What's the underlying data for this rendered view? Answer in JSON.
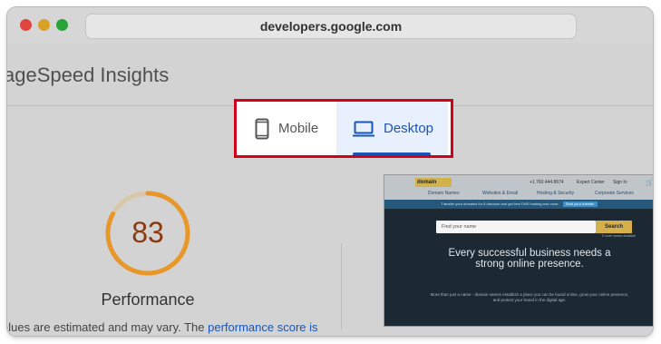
{
  "browser": {
    "url": "developers.google.com"
  },
  "page": {
    "title": "ageSpeed Insights",
    "tabs": [
      {
        "label": "Mobile",
        "icon": "phone-icon",
        "selected": false
      },
      {
        "label": "Desktop",
        "icon": "laptop-icon",
        "selected": true
      }
    ],
    "gauge": {
      "score": "83",
      "fraction": 0.83,
      "label": "Performance",
      "color": "#e8972b"
    },
    "footnote": {
      "text": "alues are estimated and may vary. The ",
      "link": "performance score is"
    }
  },
  "preview": {
    "logo": "domain",
    "phone": "+1.760.444.8674",
    "account": "Expert Center",
    "signin": "Sign In",
    "nav": [
      "Domain Names",
      "Websites & Email",
      "Hosting & Security",
      "Corporate Services"
    ],
    "banner": "Transfer your domains for 8 discount and get free DNS  hosting and more.",
    "banner_chip": "Start your transfer",
    "search_placeholder": "Find your name",
    "search_button": "Search",
    "search_under": "5 more names available",
    "headline": "Every successful business needs a strong online presence.",
    "subtext": "More than just a name - domain names establish a place you can be found online, grow your online presence, and protect your brand in the digital age."
  },
  "colors": {
    "accent": "#1a55b5",
    "highlight_border": "#d0021b",
    "gauge": "#e8972b",
    "score_text": "#8a3a10"
  }
}
